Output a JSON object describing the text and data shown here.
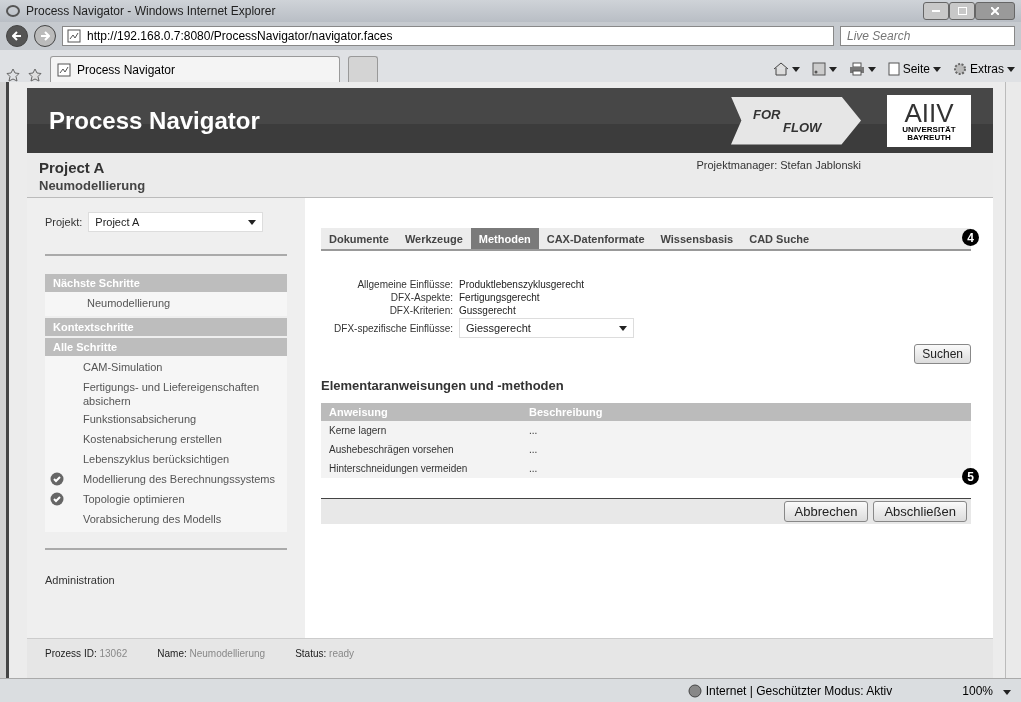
{
  "window": {
    "title": "Process Navigator - Windows Internet Explorer"
  },
  "address_bar": {
    "url": "http://192.168.0.7:8080/ProcessNavigator/navigator.faces",
    "search_placeholder": "Live Search"
  },
  "browser_tabs": [
    {
      "label": "Process Navigator",
      "selected": true
    }
  ],
  "command_bar": [
    {
      "kind": "home"
    },
    {
      "kind": "feeds"
    },
    {
      "kind": "print"
    },
    {
      "kind": "page",
      "label": "Seite"
    },
    {
      "kind": "tools",
      "label": "Extras"
    }
  ],
  "header": {
    "title": "Process Navigator",
    "logo_left": {
      "top": "FOR",
      "bottom": "FLOW"
    },
    "logo_right": {
      "top": "AIIV",
      "bottom": "UNIVERSITÄT BAYREUTH"
    }
  },
  "project": {
    "name": "Project A",
    "step": "Neumodellierung",
    "manager_label": "Projektmanager:",
    "manager": "Stefan Jablonski"
  },
  "sidebar": {
    "project_label": "Projekt:",
    "project_value": "Project A",
    "sections": [
      {
        "title": "Nächste Schritte",
        "kind": "next",
        "items": [
          {
            "label": "Neumodellierung",
            "done": false
          }
        ]
      },
      {
        "title": "Kontextschritte",
        "kind": "header"
      },
      {
        "title": "Alle Schritte",
        "kind": "list",
        "items": [
          {
            "label": "CAM-Simulation",
            "done": false
          },
          {
            "label": "Fertigungs- und Liefereigenschaften absichern",
            "done": false
          },
          {
            "label": "Funkstionsabsicherung",
            "done": false
          },
          {
            "label": "Kostenabsicherung erstellen",
            "done": false
          },
          {
            "label": "Lebenszyklus berücksichtigen",
            "done": false
          },
          {
            "label": "Modellierung des Berechnungssystems",
            "done": true
          },
          {
            "label": "Topologie optimieren",
            "done": true
          },
          {
            "label": "Vorabsicherung des Modells",
            "done": false
          }
        ]
      }
    ],
    "admin": "Administration"
  },
  "tabs": [
    {
      "label": "Dokumente",
      "selected": false
    },
    {
      "label": "Werkzeuge",
      "selected": false
    },
    {
      "label": "Methoden",
      "selected": true
    },
    {
      "label": "CAX-Datenformate",
      "selected": false
    },
    {
      "label": "Wissensbasis",
      "selected": false
    },
    {
      "label": "CAD Suche",
      "selected": false
    }
  ],
  "annotations": [
    "4",
    "5"
  ],
  "form": [
    {
      "label": "Allgemeine Einflüsse:",
      "value": "Produktlebenszyklusgerecht",
      "kind": "text"
    },
    {
      "label": "DFX-Aspekte:",
      "value": "Fertigungsgerecht",
      "kind": "text"
    },
    {
      "label": "DFX-Kriterien:",
      "value": "Gussgerecht",
      "kind": "text"
    },
    {
      "label": "DFX-spezifische Einflüsse:",
      "value": "Giessgerecht",
      "kind": "select"
    }
  ],
  "search_button": "Suchen",
  "section_title": "Elementaranweisungen und -methoden",
  "table": {
    "columns": [
      "Anweisung",
      "Beschreibung"
    ],
    "rows": [
      [
        "Kerne lagern",
        "..."
      ],
      [
        "Aushebeschrägen vorsehen",
        "..."
      ],
      [
        "Hinterschneidungen vermeiden",
        "..."
      ]
    ]
  },
  "actions": [
    "Abbrechen",
    "Abschließen"
  ],
  "footer": [
    {
      "label": "Prozess ID:",
      "value": "13062"
    },
    {
      "label": "Name:",
      "value": "Neumodellierung"
    },
    {
      "label": "Status:",
      "value": "ready"
    }
  ],
  "status_bar": {
    "zone": "Internet | Geschützter Modus: Aktiv",
    "zoom": "100%"
  }
}
